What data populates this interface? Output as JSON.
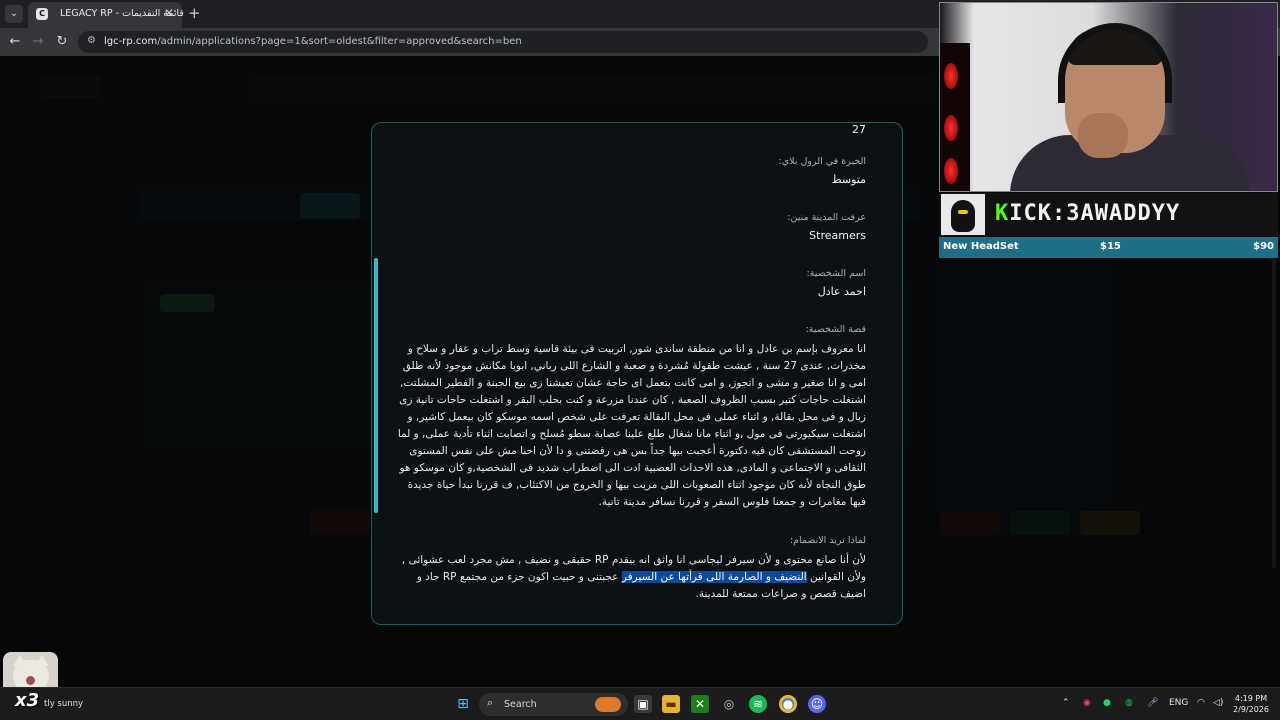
{
  "browser": {
    "tab_title": "LEGACY RP - قائمة التقديمات",
    "tab_close": "✕",
    "new_tab": "+",
    "url_host": "lgc-rp.com",
    "url_path": "/admin/applications?page=1&sort=oldest&filter=approved&search=ben"
  },
  "application": {
    "age_value": "27",
    "fields": [
      {
        "label": "الخبرة في الرول بلاي:",
        "value": "متوسط"
      },
      {
        "label": "عرفت المدينة منين:",
        "value": "Streamers"
      },
      {
        "label": "اسم الشخصية:",
        "value": "احمد عادل"
      }
    ],
    "story_label": "قصة الشخصية:",
    "story_text": "انا معروف بإسم بن عادل و انا من منطقة ساندى شور, اتربيت فى بيئة قاسية وسط تراب و عفار و سلاح و مخدرات, عندى 27 سنة , عيشت طفولة مُشردة و صعبة و الشارع اللى رباني, ابويا مكانش موجود لأنه طلق امى و انا صغير و مشى و اتجوز, و امى كانت بتعمل اى حاجة عشان تعيشنا زى بيع الجبنة و الفطير المشلتت, اشتغلت حاجات كتير بسبب الظروف الصعبة , كان عندنا مزرعة و كنت بحلب البقر و اشتغلت حاجات تانية زى زبال و فى محل بقالة, و اثناء عملى فى محل البقالة تعرفت على شخص اسمه موسكو كان بيعمل كاشير, و اشتغلت سيكيورتى فى مول ,و اثناء مانا شغال طلع علينا عصابة سطو مُسلح و اتصابت اثناء تأدية عملى, و لما روحت المستشفى كان فيه دكتورة أعجبت بيها جداً بس هى رفضتنى و دا لأن احنا مش على نفس المستوى الثقافى و الاجتماعى و المادى, هذه الاحداث العصبية ادت الى اضطراب شديد فى الشخصية,و كان موسكو هو طوق النجاه لأنه كان موجود اثناء الصعوبات اللى مريت بيها و الخروج من الاكتئاب, ف قررنا نبدأ حياة جديدة فيها مغامرات و جمعنا فلوس السفر و قررنا نسافر مدينة تانية.",
    "why_label": "لماذا تريد الانضمام:",
    "why_text_1": "لأن أنا صانع محتوى و لأن سيرفر ليجاسى انا واثق انه بيقدم RP حقيقى و نضيف , مش مجرد لعب عشوائى , ولأن القوانين ",
    "why_text_highlight": "النضيف و الصارمة اللى قرأتها عن السيرفر",
    "why_text_2": " عجبتنى و حبيت اكون جزء من مجتمع RP جاد و اضيف قصص و صراعات ممتعة للمدينة."
  },
  "stream": {
    "kick_prefix": "K",
    "kick_rest": "ICK:3AWADDYY",
    "goal_name": "New HeadSet",
    "goal_current": "$15",
    "goal_total": "$90",
    "sticker_text": "x3"
  },
  "taskbar": {
    "weather_text": "tly sunny",
    "search_label": "Search",
    "language": "ENG",
    "time": "4:19 PM",
    "date": "2/9/2026"
  },
  "colors": {
    "modal_border": "#1f5c5e",
    "scroll_accent": "#3fb7c2",
    "selection": "#0e4a9a",
    "kick_green": "#53fc18",
    "goal_bar": "#1e6e86"
  }
}
